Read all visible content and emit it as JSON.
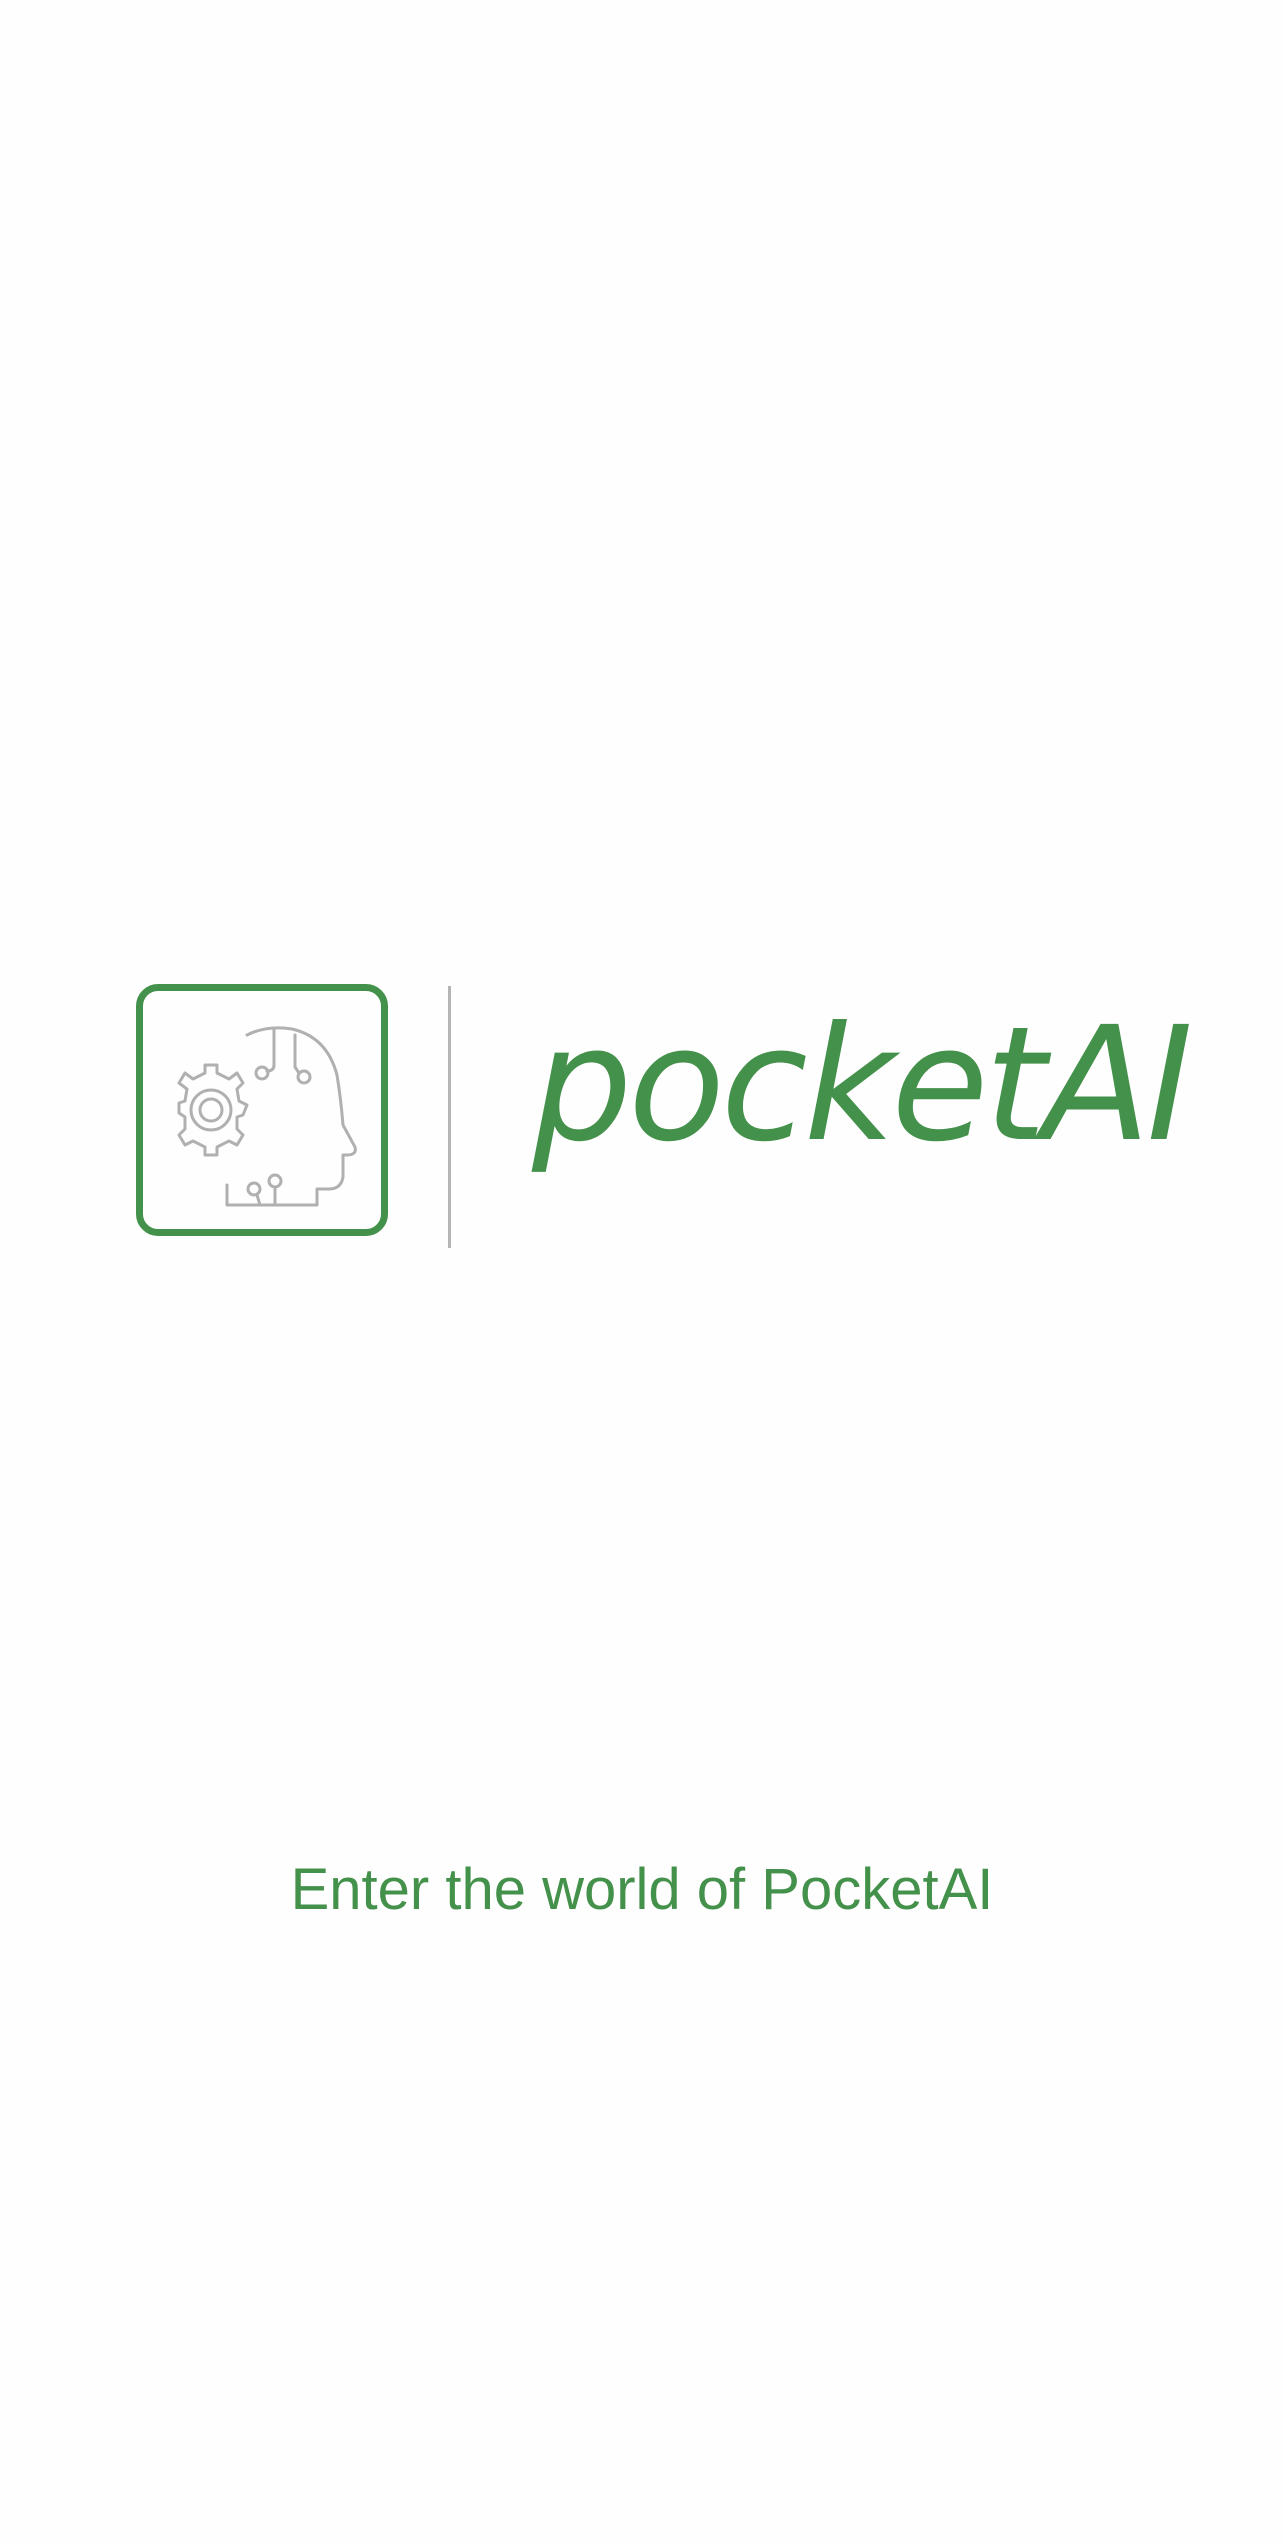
{
  "brand": {
    "name": "pocketAI",
    "logo_icon": "ai-head-gear-icon",
    "color": "#43914a"
  },
  "tagline": "Enter the world of PocketAI"
}
